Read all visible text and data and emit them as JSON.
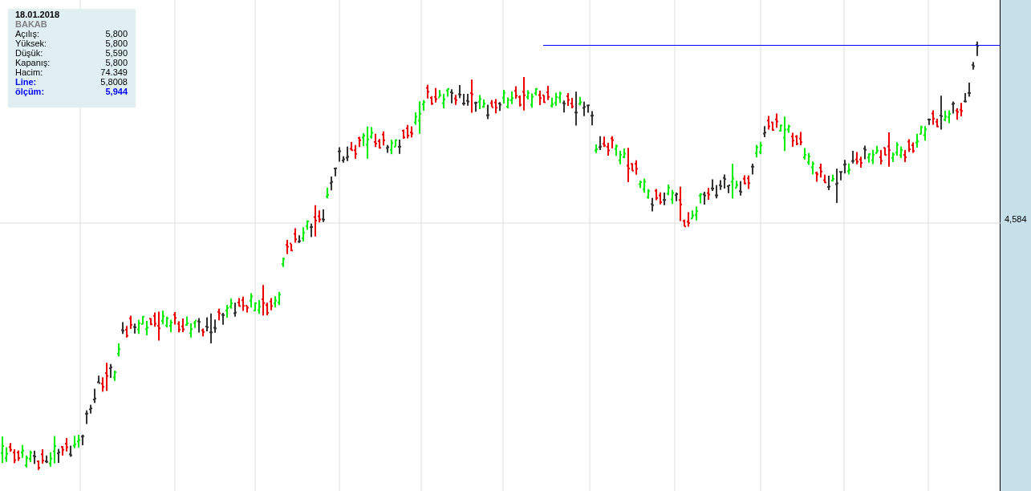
{
  "info_panel": {
    "date": "18.01.2018",
    "symbol": "BAKAB",
    "rows": [
      {
        "label": "Açılış:",
        "value": "5,800",
        "kind": "plain"
      },
      {
        "label": "Yüksek:",
        "value": "5,800",
        "kind": "plain"
      },
      {
        "label": "Düşük:",
        "value": "5,590",
        "kind": "plain"
      },
      {
        "label": "Kapanış:",
        "value": "5,800",
        "kind": "plain"
      },
      {
        "label": "Hacim:",
        "value": "74.349",
        "kind": "plain"
      },
      {
        "label": "Line:",
        "value": "5,8008",
        "kind": "line"
      },
      {
        "label": "ölçüm:",
        "value": "5,944",
        "kind": "measure"
      }
    ]
  },
  "price_axis": {
    "label": "4,584"
  }
}
